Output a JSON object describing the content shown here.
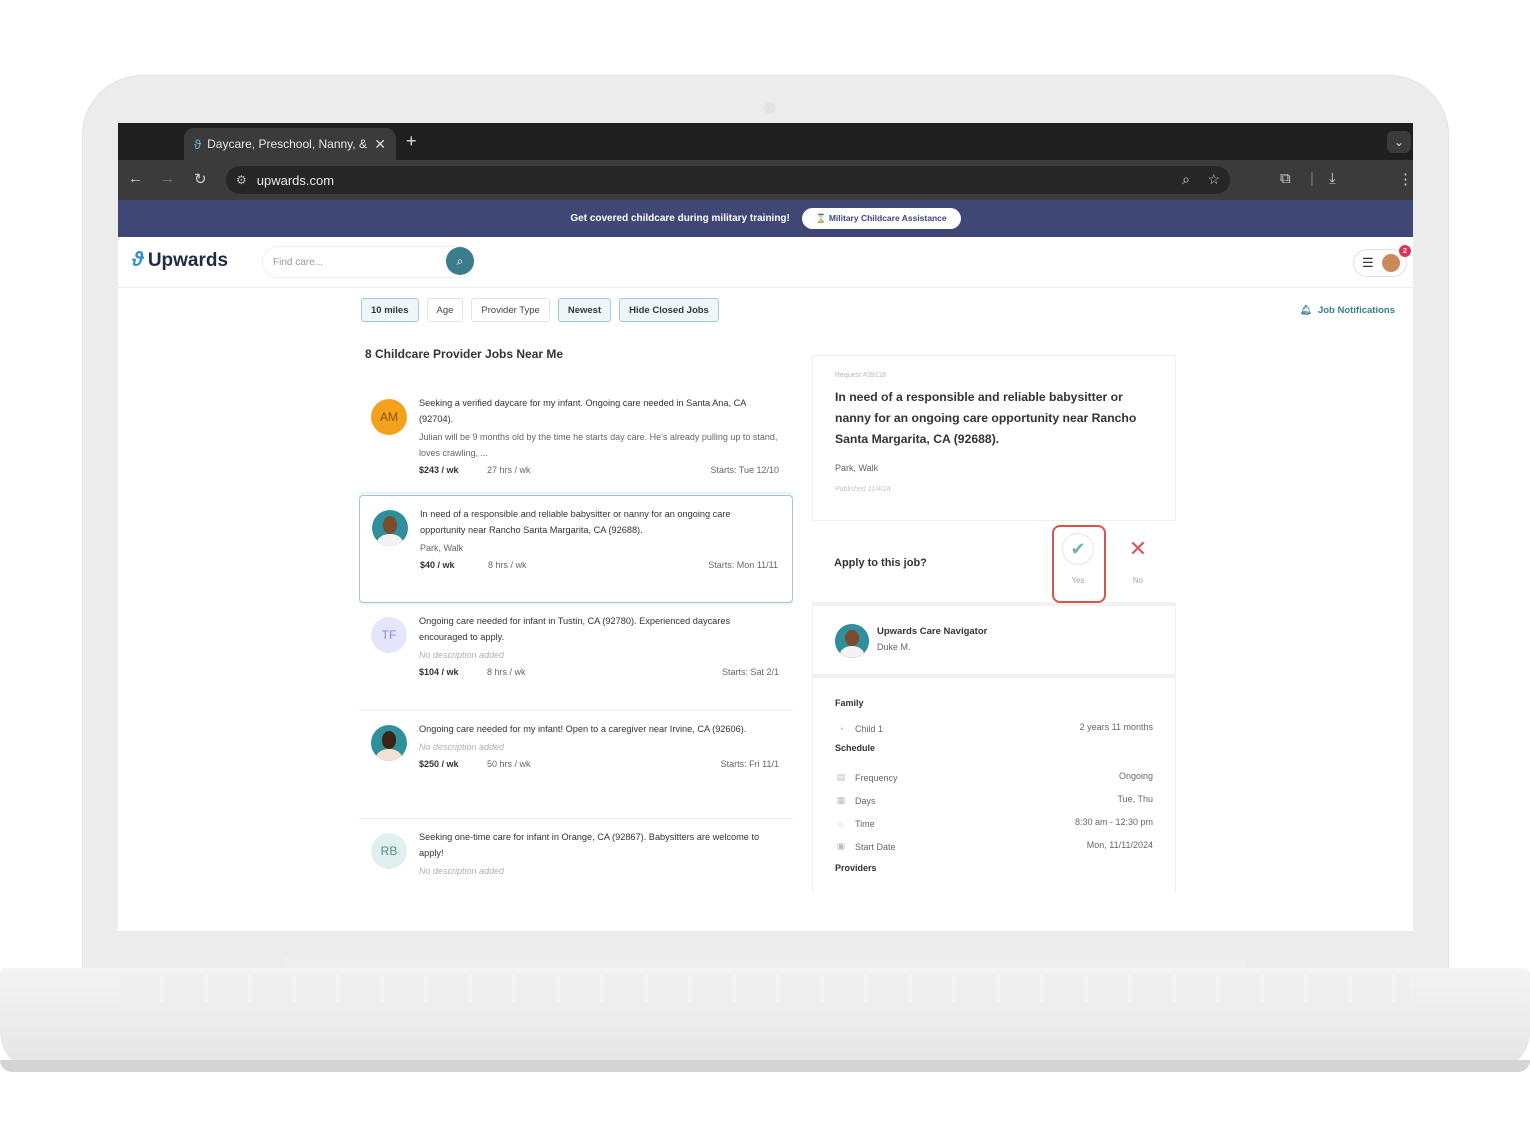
{
  "browser": {
    "tab_title": "Daycare, Preschool, Nanny, &",
    "url": "upwards.com"
  },
  "promo": {
    "text": "Get covered childcare during military training!",
    "button": "Military Childcare Assistance"
  },
  "header": {
    "logo": "Upwards",
    "search_placeholder": "Find care...",
    "notification_count": "2"
  },
  "filters": [
    "10 miles",
    "Age",
    "Provider Type",
    "Newest",
    "Hide Closed Jobs"
  ],
  "job_notifications": "Job Notifications",
  "list_title": "8 Childcare Provider Jobs Near Me",
  "jobs": [
    {
      "initials": "AM",
      "title": "Seeking a verified daycare for my infant. Ongoing care needed in Santa Ana, CA (92704).",
      "desc": "Julian will be 9 months old by the time he starts day care. He's already pulling up to stand, loves crawling, ...",
      "rate": "$243 / wk",
      "hours": "27 hrs / wk",
      "starts": "Starts: Tue 12/10"
    },
    {
      "initials": "",
      "title": "In need of a responsible and reliable babysitter or nanny for an ongoing care opportunity near Rancho Santa Margarita, CA (92688).",
      "desc": "Park, Walk",
      "rate": "$40 / wk",
      "hours": "8 hrs / wk",
      "starts": "Starts: Mon 11/11"
    },
    {
      "initials": "TF",
      "title": "Ongoing care needed for infant in Tustin, CA (92780). Experienced daycares encouraged to apply.",
      "desc": "No description added",
      "rate": "$104 / wk",
      "hours": "8 hrs / wk",
      "starts": "Starts: Sat 2/1"
    },
    {
      "initials": "",
      "title": "Ongoing care needed for my infant! Open to a caregiver near Irvine, CA (92606).",
      "desc": "No description added",
      "rate": "$250 / wk",
      "hours": "50 hrs / wk",
      "starts": "Starts: Fri 11/1"
    },
    {
      "initials": "RB",
      "title": "Seeking one-time care for infant in Orange, CA (92867). Babysitters are welcome to apply!",
      "desc": "No description added",
      "rate": "",
      "hours": "",
      "starts": ""
    }
  ],
  "detail": {
    "request_id": "Request #39118",
    "title": "In need of a responsible and reliable babysitter or nanny for an ongoing care opportunity near Rancho Santa Margarita, CA (92688).",
    "tags": "Park, Walk",
    "published": "Published 11/4/24",
    "apply_label": "Apply to this job?",
    "yes": "Yes",
    "no": "No",
    "navigator_title": "Upwards Care Navigator",
    "navigator_name": "Duke M.",
    "family_head": "Family",
    "child_label": "Child 1",
    "child_age": "2 years 11 months",
    "schedule_head": "Schedule",
    "frequency_label": "Frequency",
    "frequency_value": "Ongoing",
    "days_label": "Days",
    "days_value": "Tue, Thu",
    "time_label": "Time",
    "time_value": "8:30 am - 12:30 pm",
    "start_label": "Start Date",
    "start_value": "Mon, 11/11/2024",
    "providers_head": "Providers"
  },
  "colors": {
    "brand_navy": "#3f4775",
    "accent_teal": "#3a7d8c",
    "highlight_red": "#d9534f"
  }
}
